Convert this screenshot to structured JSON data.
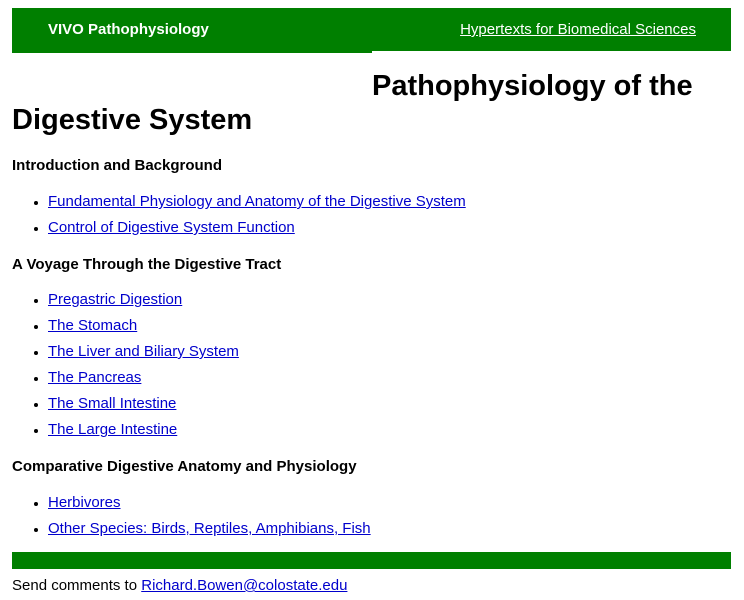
{
  "header": {
    "brand": "VIVO Pathophysiology",
    "link": "Hypertexts for Biomedical Sciences",
    "color": "#007f00"
  },
  "title": {
    "line1": "Pathophysiology of the",
    "line2": "Digestive System"
  },
  "sections": [
    {
      "heading": "Introduction and Background",
      "links": [
        "Fundamental Physiology and Anatomy of the Digestive System",
        "Control of Digestive System Function"
      ]
    },
    {
      "heading": "A Voyage Through the Digestive Tract",
      "links": [
        "Pregastric Digestion",
        "The Stomach",
        "The Liver and Biliary System",
        "The Pancreas",
        "The Small Intestine",
        "The Large Intestine"
      ]
    },
    {
      "heading": "Comparative Digestive Anatomy and Physiology",
      "links": [
        "Herbivores",
        "Other Species: Birds, Reptiles, Amphibians, Fish"
      ]
    }
  ],
  "footer": {
    "text": "Send comments to ",
    "email": "Richard.Bowen@colostate.edu"
  }
}
